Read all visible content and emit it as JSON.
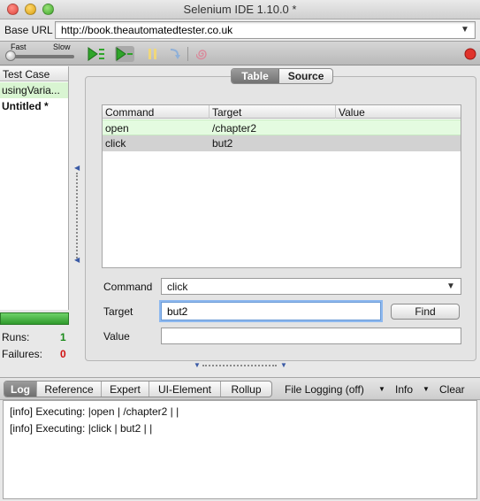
{
  "window": {
    "title": "Selenium IDE 1.10.0 *"
  },
  "base_url": {
    "label": "Base URL",
    "value": "http://book.theautomatedtester.co.uk"
  },
  "toolbar": {
    "speed_fast_label": "Fast",
    "speed_slow_label": "Slow",
    "speed_level": 0.0
  },
  "test_cases": {
    "header": "Test Case",
    "items": [
      {
        "label": "usingVaria...",
        "status": "passed"
      },
      {
        "label": "Untitled *",
        "status": "current"
      }
    ]
  },
  "stats": {
    "runs_label": "Runs:",
    "runs_value": "1",
    "failures_label": "Failures:",
    "failures_value": "0",
    "progress_fraction": 1.0
  },
  "editor": {
    "tabs": [
      {
        "label": "Table",
        "active": true
      },
      {
        "label": "Source",
        "active": false
      }
    ],
    "table": {
      "headers": [
        "Command",
        "Target",
        "Value"
      ],
      "rows": [
        {
          "command": "open",
          "target": "/chapter2",
          "value": ""
        },
        {
          "command": "click",
          "target": "but2",
          "value": ""
        }
      ]
    },
    "command_label": "Command",
    "command_value": "click",
    "target_label": "Target",
    "target_value": "but2",
    "find_label": "Find",
    "value_label": "Value",
    "value_value": ""
  },
  "log_panel": {
    "tabs": [
      "Log",
      "Reference",
      "Expert",
      "UI-Element",
      "Rollup"
    ],
    "file_logging_label": "File Logging (off)",
    "info_label": "Info",
    "clear_label": "Clear",
    "lines": [
      "[info] Executing: |open | /chapter2 | |",
      "[info] Executing: |click | but2 | |"
    ]
  },
  "colors": {
    "pass_row": "#e4fbe0",
    "selected_row": "#d2d2d2",
    "progress": "#3fb43a",
    "runs": "#1a8a1a",
    "failures": "#d01010",
    "record": "#e0332b"
  }
}
